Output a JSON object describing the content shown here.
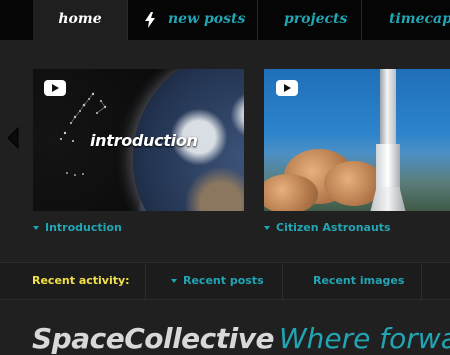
{
  "nav": {
    "items": [
      {
        "label": "home",
        "active": true
      },
      {
        "label": "new posts",
        "icon": "lightning-icon"
      },
      {
        "label": "projects"
      },
      {
        "label": "timecapsu"
      }
    ]
  },
  "carousel": {
    "prev_icon": "chevron-left-icon",
    "slides": [
      {
        "overlay_title": "introduction",
        "caption": "Introduction",
        "video_icon": "youtube-play-icon"
      },
      {
        "overlay_title": "",
        "caption": "Citizen Astronauts",
        "video_icon": "youtube-play-icon"
      }
    ]
  },
  "activity": {
    "label": "Recent activity:",
    "tabs": [
      "Recent posts",
      "Recent images"
    ]
  },
  "footer": {
    "brand": "SpaceCollective",
    "tagline": "Where forwar"
  },
  "colors": {
    "accent": "#22a5b3",
    "highlight": "#f2e04b",
    "background": "#202020",
    "nav_background": "#050505"
  }
}
